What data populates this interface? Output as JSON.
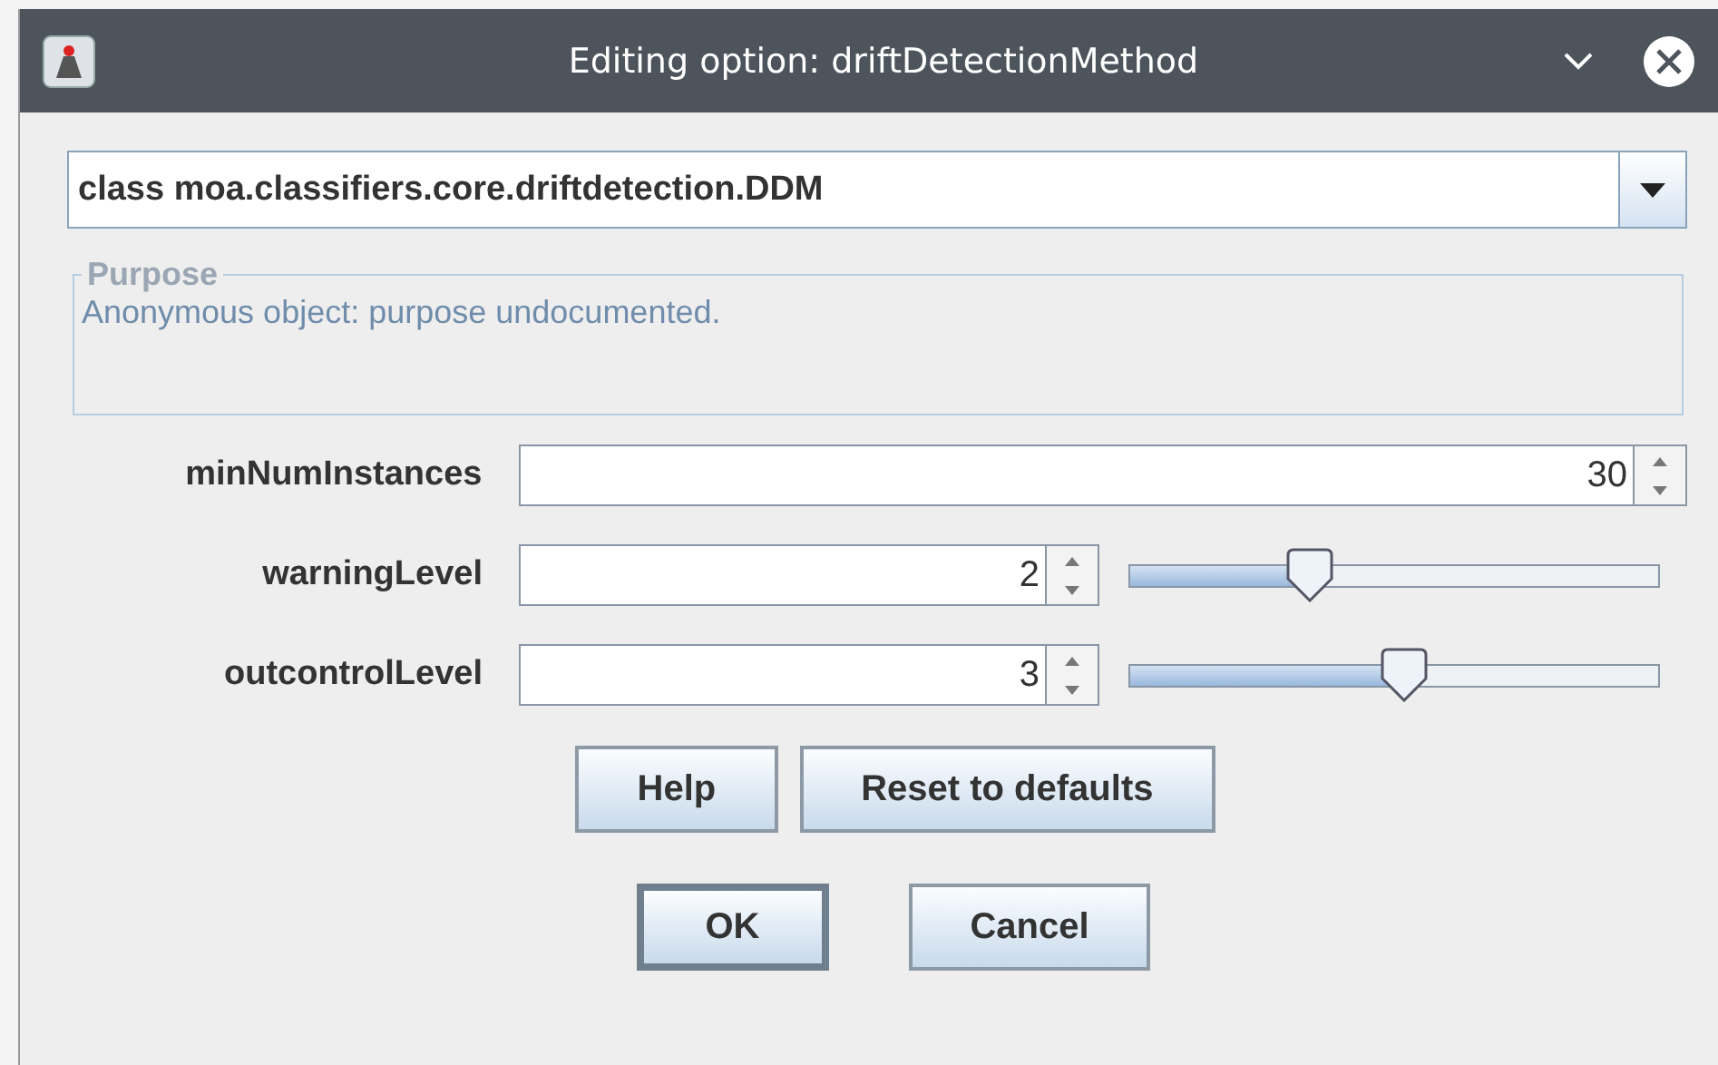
{
  "window": {
    "title": "Editing option: driftDetectionMethod"
  },
  "class_select": {
    "value": "class moa.classifiers.core.driftdetection.DDM"
  },
  "purpose": {
    "title": "Purpose",
    "text": "Anonymous object: purpose undocumented."
  },
  "options": [
    {
      "kind": "spinner",
      "label": "minNumInstances",
      "value": "30"
    },
    {
      "kind": "slider",
      "label": "warningLevel",
      "value": "2",
      "level": 0.34
    },
    {
      "kind": "slider",
      "label": "outcontrolLevel",
      "value": "3",
      "level": 0.52
    }
  ],
  "option_buttons": [
    "Help",
    "Reset to defaults"
  ],
  "dialog_buttons": [
    {
      "label": "OK",
      "default": true
    },
    {
      "label": "Cancel",
      "default": false
    }
  ]
}
